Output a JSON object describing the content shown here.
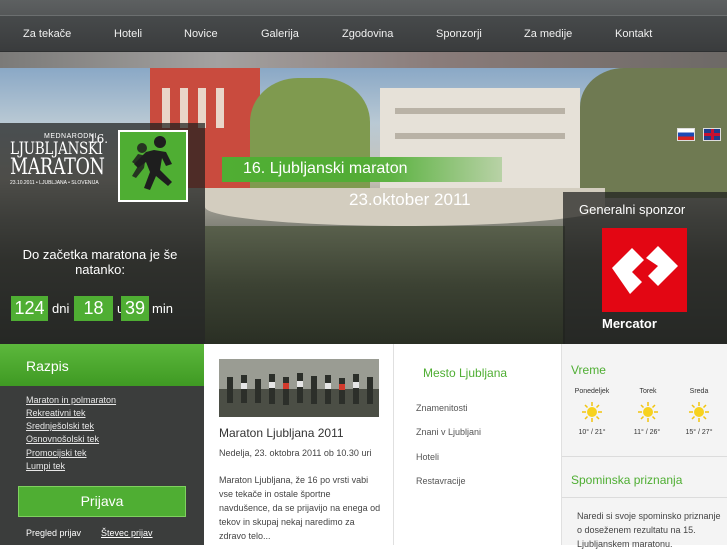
{
  "nav": {
    "items": [
      "Za tekače",
      "Hoteli",
      "Novice",
      "Galerija",
      "Zgodovina",
      "Sponzorji",
      "Za medije",
      "Kontakt"
    ]
  },
  "hero": {
    "logo": {
      "small": "MEDNARODNI",
      "number": "16.",
      "line1": "LJUBLJANSKI",
      "line2": "MARATON",
      "sub": "23.10.2011 • LJUBLJANA • SLOVENIJA"
    },
    "countdown": {
      "text": "Do začetka maratona je še natanko:",
      "days_value": "124",
      "days_unit": "dni",
      "hours_value": "18",
      "hours_unit": "ur",
      "mins_value": "39",
      "mins_unit": "min"
    },
    "title": "16. Ljubljanski maraton",
    "date": "23.oktober 2011",
    "sponsor_label": "Generalni sponzor",
    "sponsor_name": "Mercator",
    "languages": [
      "Slovenščina",
      "English"
    ]
  },
  "razpis": {
    "title": "Razpis",
    "links": [
      "Maraton in polmaraton",
      "Rekreativni tek",
      "Srednješolski tek",
      "Osnovnošolski tek",
      "Promocijski tek",
      "Lumpi tek"
    ],
    "prijava_label": "Prijava",
    "sub_links": [
      "Pregled prijav",
      "Števec prijav"
    ]
  },
  "news": {
    "title": "Maraton Ljubljana 2011",
    "date": "Nedelja, 23. oktobra 2011 ob 10.30 uri",
    "text": "Maraton Ljubljana, že 16 po vrsti vabi vse tekače in ostale športne navdušence, da se prijavijo na enega od tekov in skupaj nekaj naredimo za zdravo telo..."
  },
  "mesto": {
    "title": "Mesto Ljubljana",
    "links": [
      "Znamenitosti",
      "Znani v Ljubljani",
      "Hoteli",
      "Restavracije"
    ]
  },
  "vreme": {
    "title": "Vreme",
    "days": [
      {
        "name": "Ponedeljek",
        "temp": "10° / 21°"
      },
      {
        "name": "Torek",
        "temp": "11° / 26°"
      },
      {
        "name": "Sreda",
        "temp": "15° / 27°"
      }
    ]
  },
  "spominska": {
    "title": "Spominska priznanja",
    "text": "Naredi si svoje spominsko priznanje o doseženem rezultatu na 15. Ljubljanskem maratonu."
  },
  "colors": {
    "accent_green": "#4fae33",
    "nav_dark": "#3a3c3d",
    "sponsor_red": "#e30613"
  }
}
